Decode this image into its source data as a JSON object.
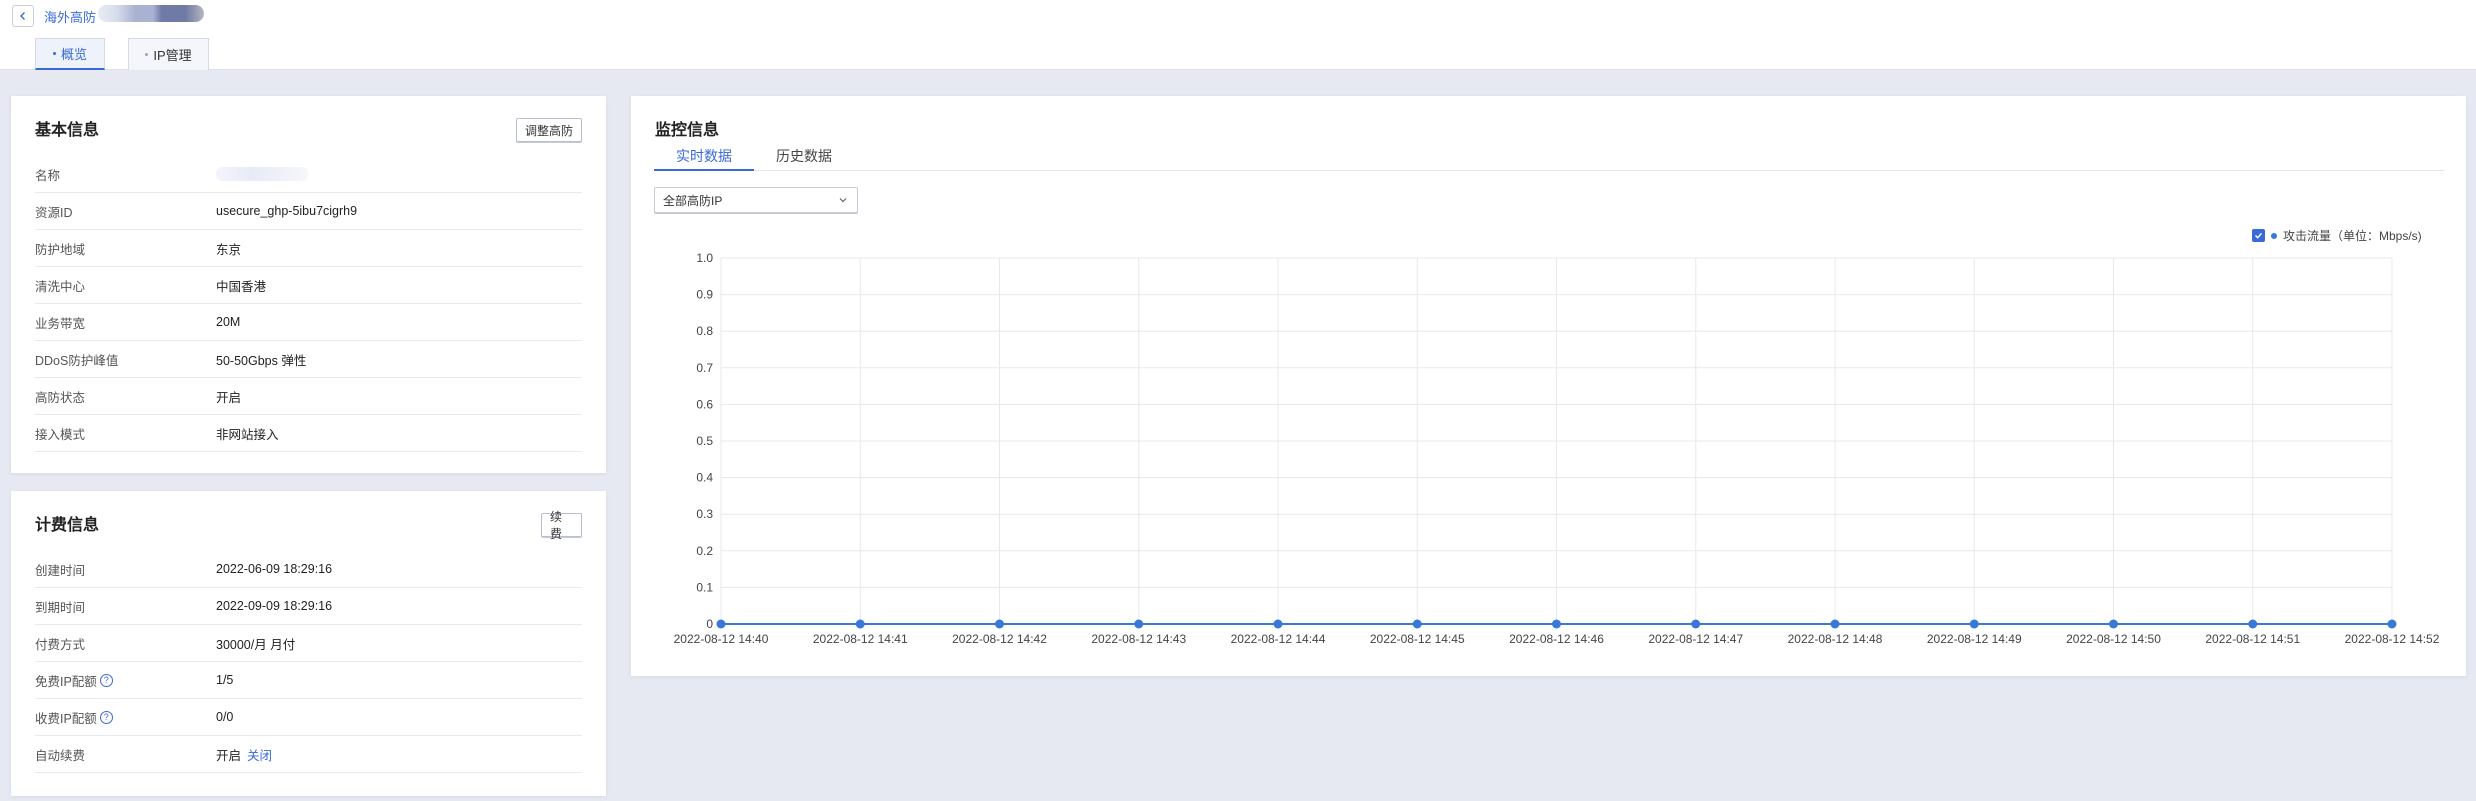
{
  "breadcrumb": {
    "text": "海外高防"
  },
  "tabs": [
    {
      "label": "概览"
    },
    {
      "label": "IP管理"
    }
  ],
  "basic_info": {
    "title": "基本信息",
    "button": "调整高防",
    "rows": [
      {
        "label": "名称",
        "value": ""
      },
      {
        "label": "资源ID",
        "value": "usecure_ghp-5ibu7cigrh9"
      },
      {
        "label": "防护地域",
        "value": "东京"
      },
      {
        "label": "清洗中心",
        "value": "中国香港"
      },
      {
        "label": "业务带宽",
        "value": "20M"
      },
      {
        "label": "DDoS防护峰值",
        "value": "50-50Gbps 弹性"
      },
      {
        "label": "高防状态",
        "value": "开启"
      },
      {
        "label": "接入模式",
        "value": "非网站接入"
      }
    ]
  },
  "billing_info": {
    "title": "计费信息",
    "button": "续费",
    "rows": [
      {
        "label": "创建时间",
        "value": "2022-06-09 18:29:16"
      },
      {
        "label": "到期时间",
        "value": "2022-09-09 18:29:16"
      },
      {
        "label": "付费方式",
        "value": "30000/月 月付"
      },
      {
        "label": "免费IP配额",
        "value": "1/5"
      },
      {
        "label": "收费IP配额",
        "value": "0/0"
      },
      {
        "label": "自动续费",
        "value": "开启",
        "link": "关闭"
      }
    ]
  },
  "monitor": {
    "title": "监控信息",
    "tabs": [
      "实时数据",
      "历史数据"
    ],
    "select_value": "全部高防IP",
    "legend": "攻击流量（单位：Mbps/s)",
    "colors": {
      "accent": "#3a6ad6",
      "series": "#3a78d8",
      "grid": "#e6e8ee"
    }
  },
  "chart_data": {
    "type": "line",
    "title": "",
    "xlabel": "",
    "ylabel": "",
    "x": [
      "2022-08-12 14:40",
      "2022-08-12 14:41",
      "2022-08-12 14:42",
      "2022-08-12 14:43",
      "2022-08-12 14:44",
      "2022-08-12 14:45",
      "2022-08-12 14:46",
      "2022-08-12 14:47",
      "2022-08-12 14:48",
      "2022-08-12 14:49",
      "2022-08-12 14:50",
      "2022-08-12 14:51",
      "2022-08-12 14:52"
    ],
    "series": [
      {
        "name": "攻击流量（单位：Mbps/s)",
        "values": [
          0,
          0,
          0,
          0,
          0,
          0,
          0,
          0,
          0,
          0,
          0,
          0,
          0
        ]
      }
    ],
    "yticks": [
      "0",
      "0.1",
      "0.2",
      "0.3",
      "0.4",
      "0.5",
      "0.6",
      "0.7",
      "0.8",
      "0.9",
      "1.0"
    ],
    "ylim": [
      0,
      1
    ],
    "grid": true,
    "legend_position": "top-right"
  }
}
